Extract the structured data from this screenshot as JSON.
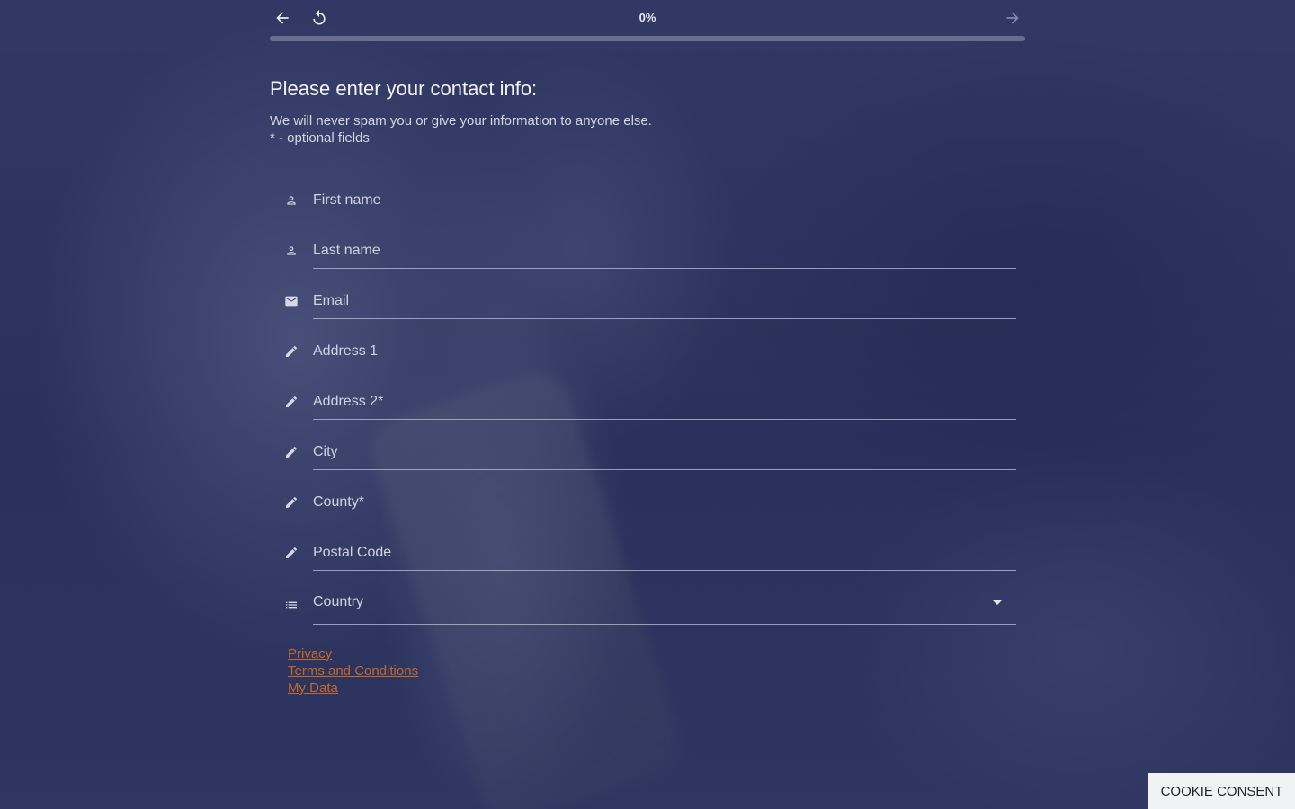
{
  "colors": {
    "overlay": "#2c3360",
    "text_primary": "#f2f3f7",
    "link": "#c4692a",
    "cookie_bg": "#f1f2f4"
  },
  "nav": {
    "back_icon": "arrow-left-icon",
    "reset_icon": "undo-icon",
    "next_icon": "arrow-right-icon",
    "progress_text": "0%",
    "progress_value": 0
  },
  "form": {
    "title": "Please enter your contact info:",
    "subtitle_line1": "We will never spam you or give your information to anyone else.",
    "subtitle_line2": "* - optional fields",
    "fields": [
      {
        "placeholder": "First name",
        "icon": "person-icon"
      },
      {
        "placeholder": "Last name",
        "icon": "person-icon"
      },
      {
        "placeholder": "Email",
        "icon": "mail-icon"
      },
      {
        "placeholder": "Address 1",
        "icon": "pencil-icon"
      },
      {
        "placeholder": "Address 2*",
        "icon": "pencil-icon"
      },
      {
        "placeholder": "City",
        "icon": "pencil-icon"
      },
      {
        "placeholder": "County*",
        "icon": "pencil-icon"
      },
      {
        "placeholder": "Postal Code",
        "icon": "pencil-icon"
      }
    ],
    "country": {
      "label": "Country",
      "icon": "list-icon"
    }
  },
  "links": {
    "privacy": "Privacy",
    "terms": "Terms and Conditions",
    "my_data": "My Data"
  },
  "cookie": {
    "label": "COOKIE CONSENT"
  }
}
